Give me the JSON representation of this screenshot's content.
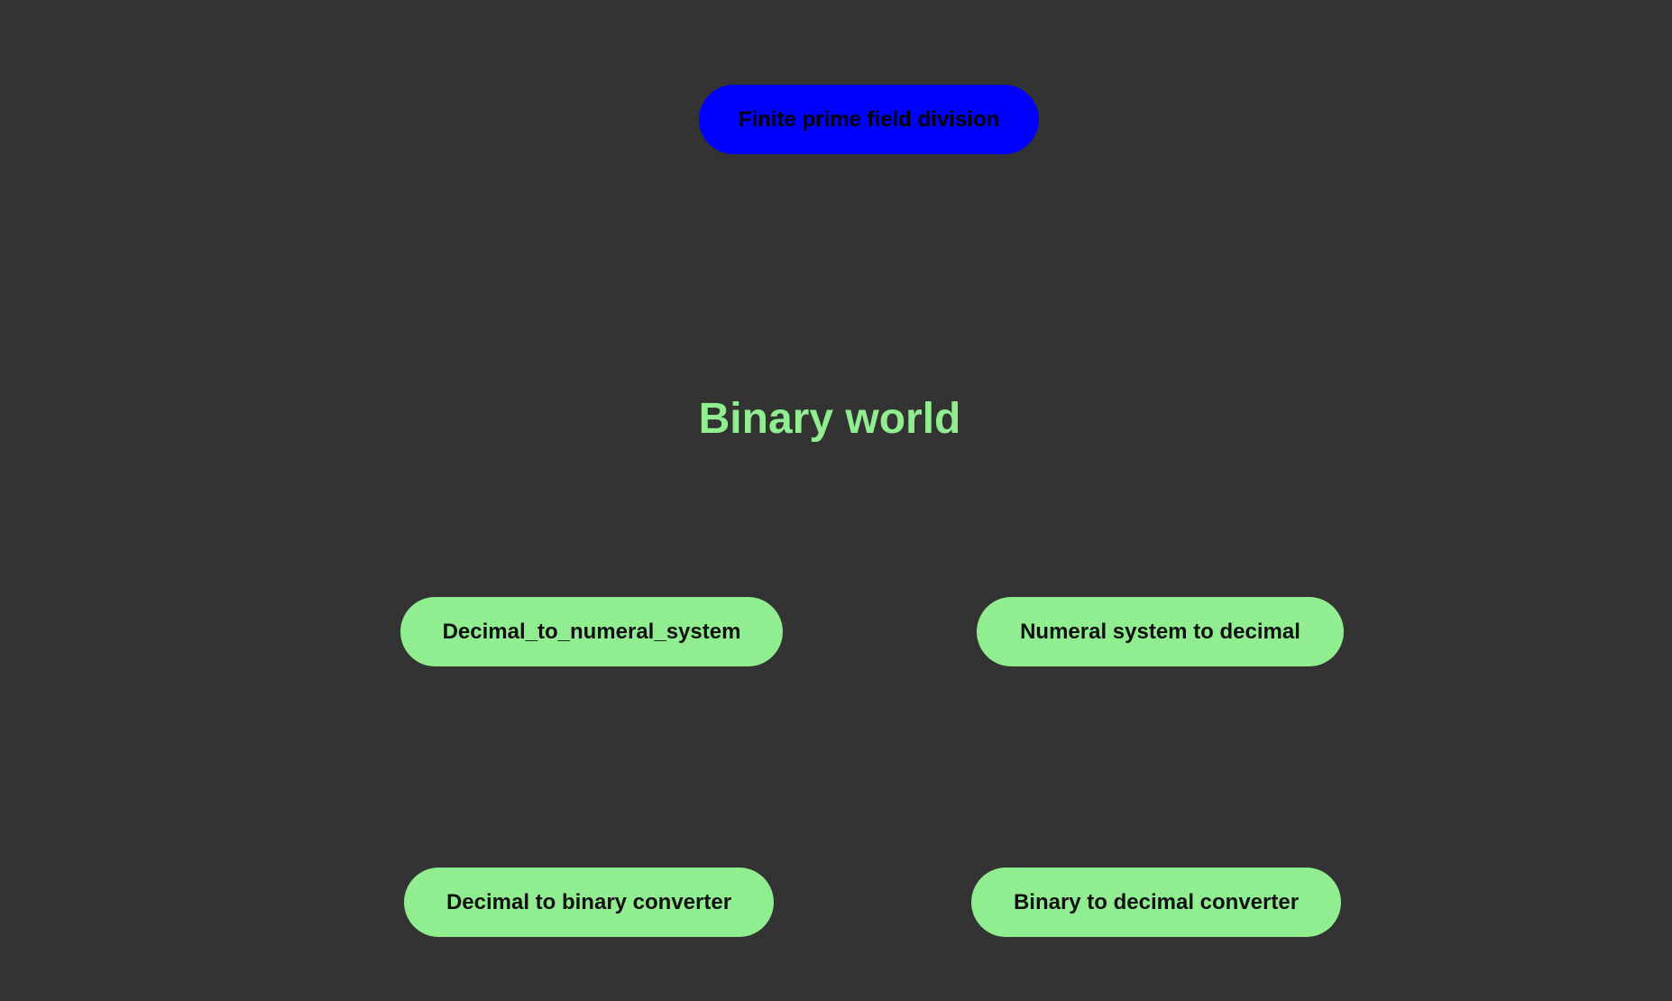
{
  "header": {
    "finite_field_button": "Finite prime field division"
  },
  "main": {
    "title": "Binary world",
    "buttons": {
      "decimal_to_numeral_system": "Decimal_to_numeral_system",
      "numeral_system_to_decimal": "Numeral system to decimal",
      "decimal_to_binary": "Decimal to binary converter",
      "binary_to_decimal": "Binary to decimal converter"
    }
  },
  "colors": {
    "background": "#333333",
    "accent_green": "#90ee90",
    "accent_blue": "#0000ff"
  }
}
